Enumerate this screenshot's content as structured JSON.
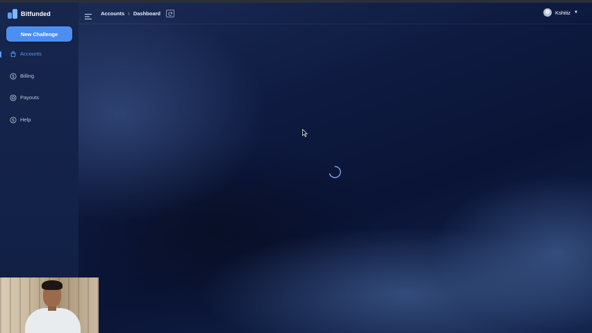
{
  "app": {
    "name": "Bitfunded"
  },
  "sidebar": {
    "new_button": "New Challenge",
    "items": [
      {
        "label": "Accounts",
        "icon": "bag-icon",
        "active": true
      },
      {
        "label": "Billing",
        "icon": "dollar-circle-icon",
        "active": false
      },
      {
        "label": "Payouts",
        "icon": "coin-icon",
        "active": false
      },
      {
        "label": "Help",
        "icon": "help-circle-icon",
        "active": false
      }
    ]
  },
  "header": {
    "breadcrumb": [
      "Accounts",
      "Dashboard"
    ],
    "user_name": "Kshitiz"
  },
  "colors": {
    "accent": "#4d8ff0",
    "active_nav": "#5d9cf5",
    "background": "#0b1330"
  },
  "status": {
    "loading": true
  }
}
